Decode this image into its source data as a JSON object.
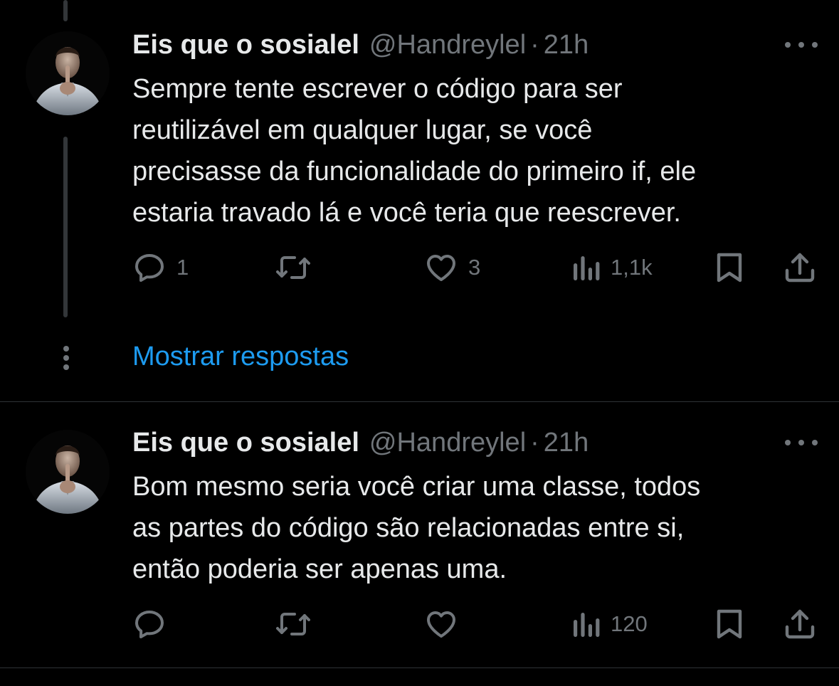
{
  "colors": {
    "background": "#000000",
    "text_primary": "#e7e9ea",
    "text_secondary": "#71767b",
    "link": "#1d9bf0",
    "divider": "#2f3336"
  },
  "tweets": [
    {
      "author_name": "Eis que o sosialel",
      "handle": "@Handreylel",
      "separator": "·",
      "time": "21h",
      "text_lines": [
        "Sempre tente escrever o código para ser",
        "reutilizável em qualquer lugar, se você",
        "precisasse da funcionalidade do primeiro if, ele",
        "estaria travado lá e você teria que reescrever."
      ],
      "replies": "1",
      "retweets": "",
      "likes": "3",
      "views": "1,1k",
      "icons": [
        "reply-icon",
        "retweet-icon",
        "like-icon",
        "views-icon",
        "bookmark-icon",
        "share-icon",
        "more-icon"
      ]
    },
    {
      "author_name": "Eis que o sosialel",
      "handle": "@Handreylel",
      "separator": "·",
      "time": "21h",
      "text_lines": [
        "Bom mesmo seria você criar uma classe, todos",
        "as partes do código são relacionadas entre si,",
        "então poderia ser apenas uma."
      ],
      "replies": "",
      "retweets": "",
      "likes": "",
      "views": "120",
      "icons": [
        "reply-icon",
        "retweet-icon",
        "like-icon",
        "views-icon",
        "bookmark-icon",
        "share-icon",
        "more-icon"
      ]
    }
  ],
  "show_replies_label": "Mostrar respostas"
}
